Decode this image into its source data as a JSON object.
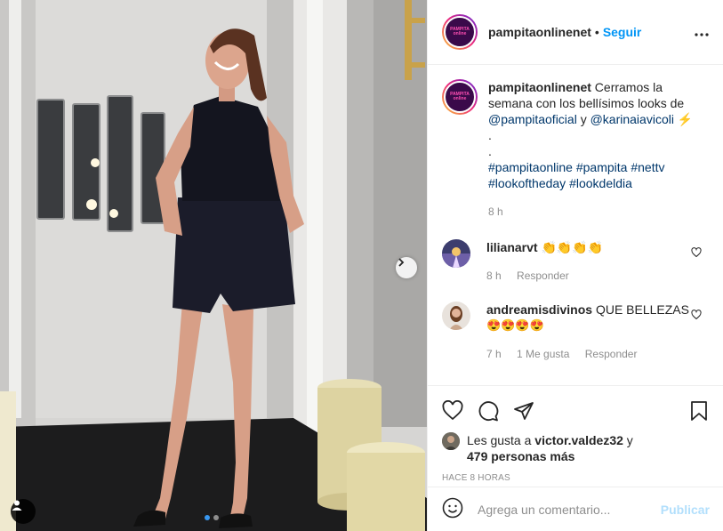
{
  "post": {
    "username": "pampitaonlinenet",
    "avatar_text_top": "PAMPITA",
    "avatar_text_bottom": "online",
    "follow_label": "Seguir",
    "more_icon": "more-horizontal-icon"
  },
  "caption": {
    "username": "pampitaonlinenet",
    "text_1": "Cerramos la semana con los bellísimos looks de",
    "mention_1": "@pampitaoficial",
    "and": "y",
    "mention_2": "@karinaiavicoli",
    "emoji": "⚡",
    "dot_1": ".",
    "dot_2": ".",
    "hashtags_line_1": "#pampitaonline #pampita #nettv",
    "hashtags_line_2": "#lookoftheday #lookdeldia",
    "time": "8 h"
  },
  "comments": [
    {
      "username": "lilianarvt",
      "text": "👏👏👏👏",
      "time": "8 h",
      "reply_label": "Responder"
    },
    {
      "username": "andreamisdivinos",
      "text": "QUE BELLEZAS",
      "emojis": "😍😍😍😍",
      "time": "7 h",
      "likes_label": "1 Me gusta",
      "reply_label": "Responder"
    }
  ],
  "likes": {
    "prefix": "Les gusta a",
    "user": "victor.valdez32",
    "joiner": "y",
    "others": "479 personas más"
  },
  "timestamp": "HACE 8 HORAS",
  "add_comment": {
    "placeholder": "Agrega un comentario...",
    "publish_label": "Publicar"
  },
  "carousel": {
    "current": 1,
    "total": 2
  },
  "colors": {
    "follow": "#0095f6",
    "link": "#00376b",
    "muted": "#8e8e8e",
    "publish_disabled": "#b2dffc",
    "carousel_active_dot": "#3897f0"
  }
}
